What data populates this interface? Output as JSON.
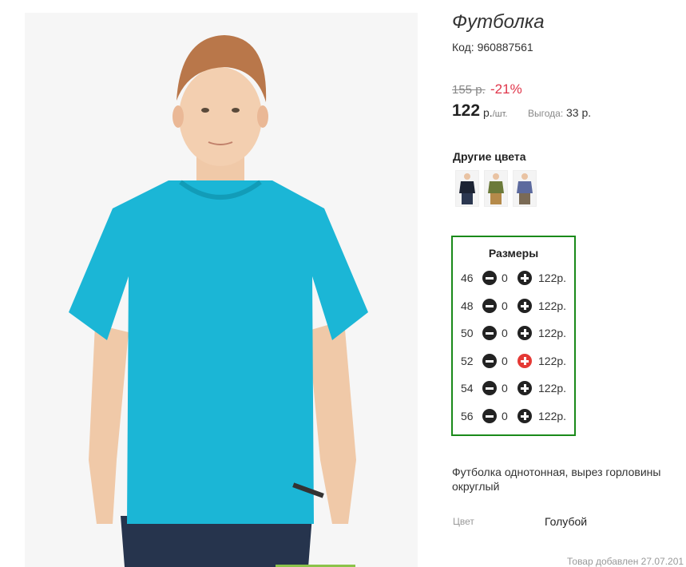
{
  "product": {
    "title": "Футболка",
    "code": "Код: 960887561",
    "image_alt": "Футболка голубая",
    "shirt_color": "#1bb6d6"
  },
  "pricing": {
    "old_price": "155 р.",
    "discount": "-21%",
    "price": "122",
    "currency": "р.",
    "per_unit": "/шт.",
    "savings_label": "Выгода:",
    "savings_value": "33 р."
  },
  "other_colors": {
    "heading": "Другие цвета",
    "swatches": [
      {
        "name": "dark-navy",
        "color": "#1c2333"
      },
      {
        "name": "olive",
        "color": "#6b7a3a"
      },
      {
        "name": "slate-blue",
        "color": "#5c6a9e"
      }
    ]
  },
  "sizes": {
    "heading": "Размеры",
    "rows": [
      {
        "size": "46",
        "qty": "0",
        "price": "122р."
      },
      {
        "size": "48",
        "qty": "0",
        "price": "122р."
      },
      {
        "size": "50",
        "qty": "0",
        "price": "122р."
      },
      {
        "size": "52",
        "qty": "0",
        "price": "122р."
      },
      {
        "size": "54",
        "qty": "0",
        "price": "122р."
      },
      {
        "size": "56",
        "qty": "0",
        "price": "122р."
      }
    ]
  },
  "description": "Футболка однотонная, вырез горловины округлый",
  "attributes": {
    "color_label": "Цвет",
    "color_value": "Голубой"
  },
  "added_date": "Товар добавлен 27.07.201",
  "colors": {
    "accent_green": "#1a8a1a",
    "discount_red": "#e0354a",
    "active_plus_red": "#e53935"
  }
}
